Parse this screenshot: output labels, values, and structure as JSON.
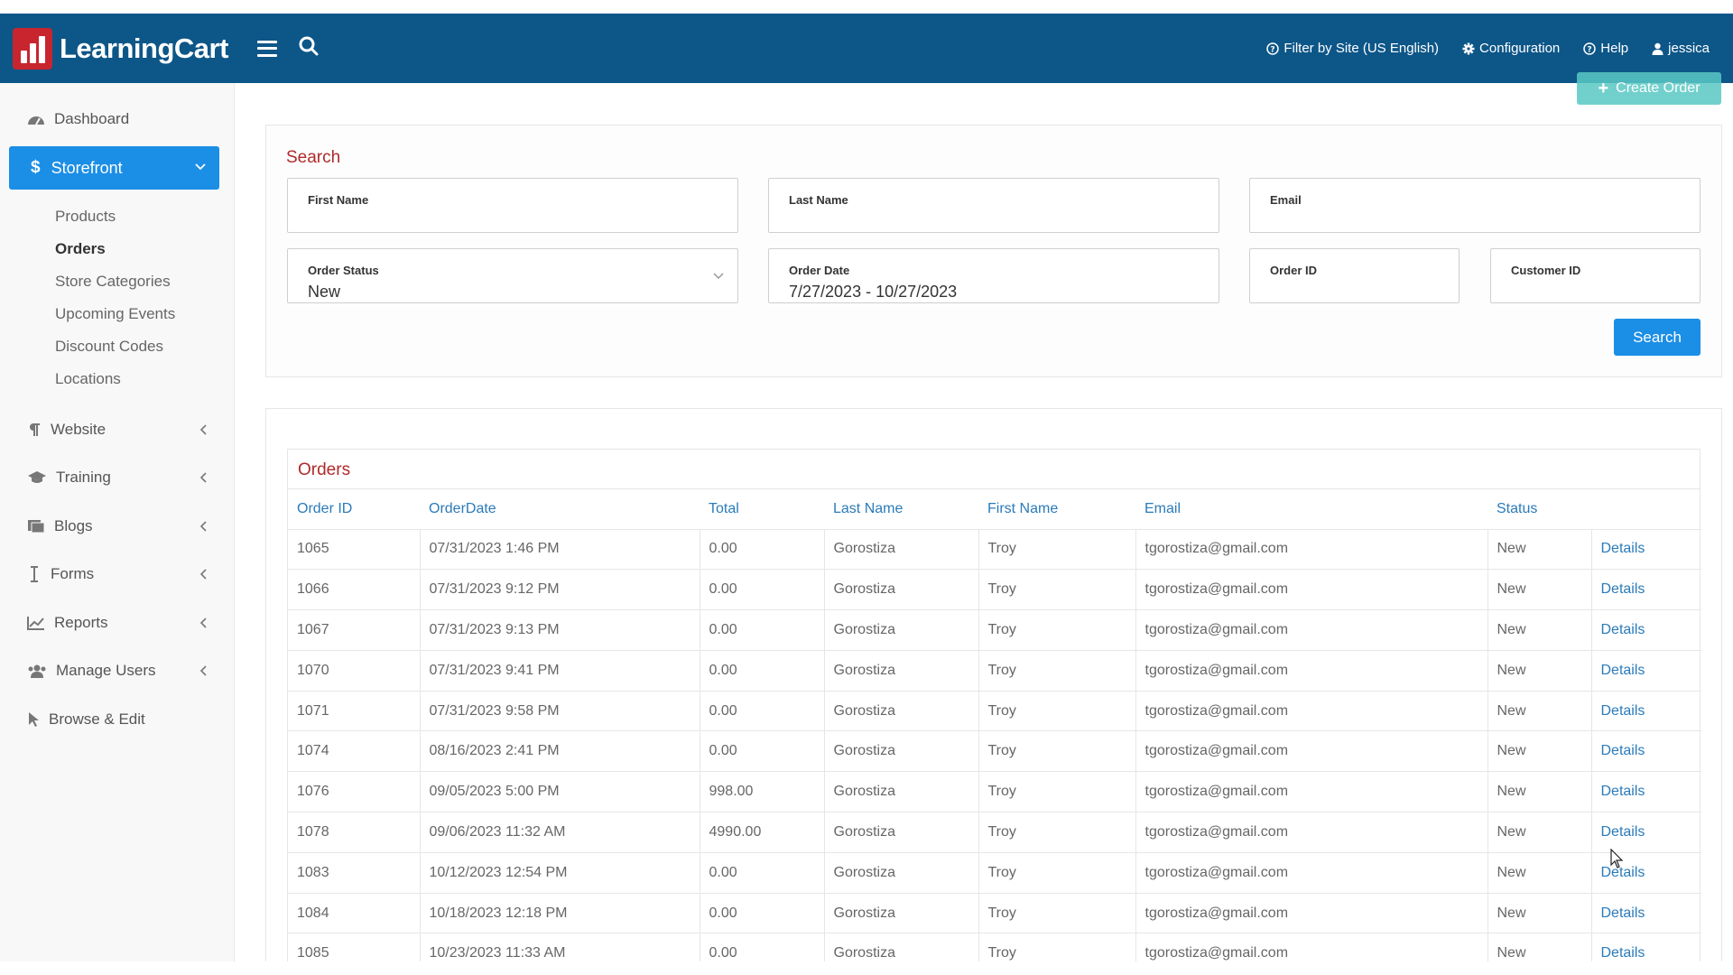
{
  "app": {
    "logo_text": "LearningCart"
  },
  "topnav": {
    "filter_label": "Filter by Site (US English)",
    "config_label": "Configuration",
    "help_label": "Help",
    "user_label": "jessica"
  },
  "sidebar": {
    "dashboard": "Dashboard",
    "storefront": "Storefront",
    "sub": [
      "Products",
      "Orders",
      "Store Categories",
      "Upcoming Events",
      "Discount Codes",
      "Locations"
    ],
    "website": "Website",
    "training": "Training",
    "blogs": "Blogs",
    "forms": "Forms",
    "reports": "Reports",
    "manage_users": "Manage Users",
    "browse_edit": "Browse & Edit"
  },
  "create_order_label": "Create Order",
  "search": {
    "title": "Search",
    "first_name_label": "First Name",
    "first_name_value": "",
    "last_name_label": "Last Name",
    "last_name_value": "",
    "email_label": "Email",
    "email_value": "",
    "order_status_label": "Order Status",
    "order_status_value": "New",
    "order_date_label": "Order Date",
    "order_date_value": "7/27/2023 - 10/27/2023",
    "order_id_label": "Order ID",
    "order_id_value": "",
    "customer_id_label": "Customer ID",
    "customer_id_value": "",
    "button_label": "Search"
  },
  "orders": {
    "title": "Orders",
    "columns": [
      "Order ID",
      "OrderDate",
      "Total",
      "Last Name",
      "First Name",
      "Email",
      "Status",
      ""
    ],
    "rows": [
      [
        "1065",
        "07/31/2023 1:46 PM",
        "0.00",
        "Gorostiza",
        "Troy",
        "tgorostiza@gmail.com",
        "New",
        "Details"
      ],
      [
        "1066",
        "07/31/2023 9:12 PM",
        "0.00",
        "Gorostiza",
        "Troy",
        "tgorostiza@gmail.com",
        "New",
        "Details"
      ],
      [
        "1067",
        "07/31/2023 9:13 PM",
        "0.00",
        "Gorostiza",
        "Troy",
        "tgorostiza@gmail.com",
        "New",
        "Details"
      ],
      [
        "1070",
        "07/31/2023 9:41 PM",
        "0.00",
        "Gorostiza",
        "Troy",
        "tgorostiza@gmail.com",
        "New",
        "Details"
      ],
      [
        "1071",
        "07/31/2023 9:58 PM",
        "0.00",
        "Gorostiza",
        "Troy",
        "tgorostiza@gmail.com",
        "New",
        "Details"
      ],
      [
        "1074",
        "08/16/2023 2:41 PM",
        "0.00",
        "Gorostiza",
        "Troy",
        "tgorostiza@gmail.com",
        "New",
        "Details"
      ],
      [
        "1076",
        "09/05/2023 5:00 PM",
        "998.00",
        "Gorostiza",
        "Troy",
        "tgorostiza@gmail.com",
        "New",
        "Details"
      ],
      [
        "1078",
        "09/06/2023 11:32 AM",
        "4990.00",
        "Gorostiza",
        "Troy",
        "tgorostiza@gmail.com",
        "New",
        "Details"
      ],
      [
        "1083",
        "10/12/2023 12:54 PM",
        "0.00",
        "Gorostiza",
        "Troy",
        "tgorostiza@gmail.com",
        "New",
        "Details"
      ],
      [
        "1084",
        "10/18/2023 12:18 PM",
        "0.00",
        "Gorostiza",
        "Troy",
        "tgorostiza@gmail.com",
        "New",
        "Details"
      ],
      [
        "1085",
        "10/23/2023 11:33 AM",
        "0.00",
        "Gorostiza",
        "Troy",
        "tgorostiza@gmail.com",
        "New",
        "Details"
      ]
    ]
  },
  "colors": {
    "topbar": "#0d5688",
    "accent": "#1b8ee6",
    "section_title": "#b02a2a",
    "link": "#2b7bb9"
  }
}
